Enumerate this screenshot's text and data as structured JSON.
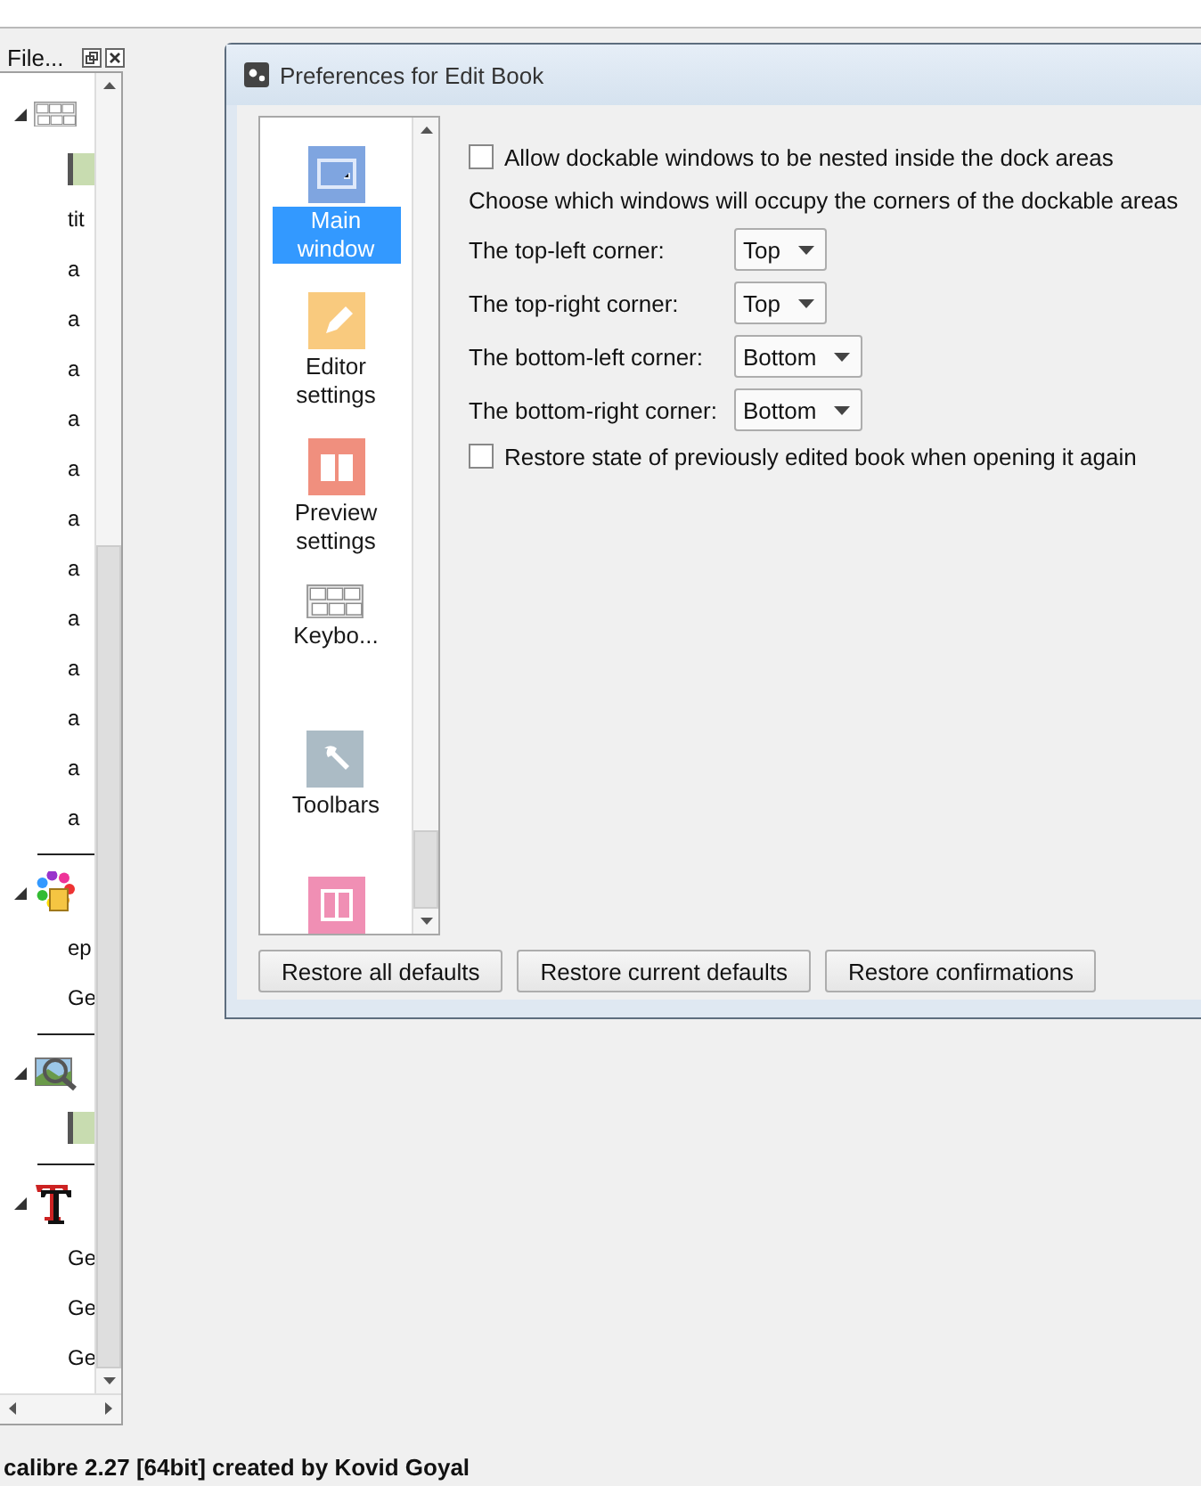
{
  "dock": {
    "title": "File...",
    "tree": [
      {
        "expanded": true,
        "children": [
          {
            "kind": "bar"
          },
          {
            "kind": "text",
            "text": "tit"
          },
          {
            "kind": "text",
            "text": "a"
          },
          {
            "kind": "text",
            "text": "a"
          },
          {
            "kind": "text",
            "text": "a"
          },
          {
            "kind": "text",
            "text": "a"
          },
          {
            "kind": "text",
            "text": "a"
          },
          {
            "kind": "text",
            "text": "a"
          },
          {
            "kind": "text",
            "text": "a"
          },
          {
            "kind": "text",
            "text": "a"
          },
          {
            "kind": "text",
            "text": "a"
          },
          {
            "kind": "text",
            "text": "a"
          },
          {
            "kind": "text",
            "text": "a"
          },
          {
            "kind": "text",
            "text": "a"
          }
        ]
      },
      {
        "expanded": true,
        "children": [
          {
            "kind": "text",
            "text": "ep"
          },
          {
            "kind": "text",
            "text": "Ge"
          }
        ]
      },
      {
        "expanded": true,
        "children": [
          {
            "kind": "bar"
          }
        ]
      },
      {
        "expanded": true,
        "children": [
          {
            "kind": "text",
            "text": "Ge"
          },
          {
            "kind": "text",
            "text": "Ge"
          },
          {
            "kind": "text",
            "text": "Ge"
          }
        ]
      }
    ]
  },
  "dialog": {
    "title": "Preferences for Edit Book",
    "sections": [
      {
        "label": "Main window",
        "selected": true
      },
      {
        "label": "Editor settings",
        "selected": false
      },
      {
        "label": "Preview settings",
        "selected": false
      },
      {
        "label": "Keybo...",
        "selected": false
      },
      {
        "label": "Toolbars",
        "selected": false
      },
      {
        "kind": "picture"
      }
    ],
    "nested": {
      "label": "Allow dockable windows to be nested inside the dock areas",
      "checked": false
    },
    "corners_heading": "Choose which windows will occupy the corners of the dockable areas",
    "corners": [
      {
        "label": "The top-left corner:",
        "value": "Top"
      },
      {
        "label": "The top-right corner:",
        "value": "Top"
      },
      {
        "label": "The bottom-left corner:",
        "value": "Bottom"
      },
      {
        "label": "The bottom-right corner:",
        "value": "Bottom"
      }
    ],
    "restore_state": {
      "label": "Restore state of previously edited book when opening it again",
      "checked": false
    },
    "buttons": [
      "Restore all defaults",
      "Restore current defaults",
      "Restore confirmations"
    ]
  },
  "status_bar": "calibre 2.27 [64bit] created by Kovid Goyal"
}
